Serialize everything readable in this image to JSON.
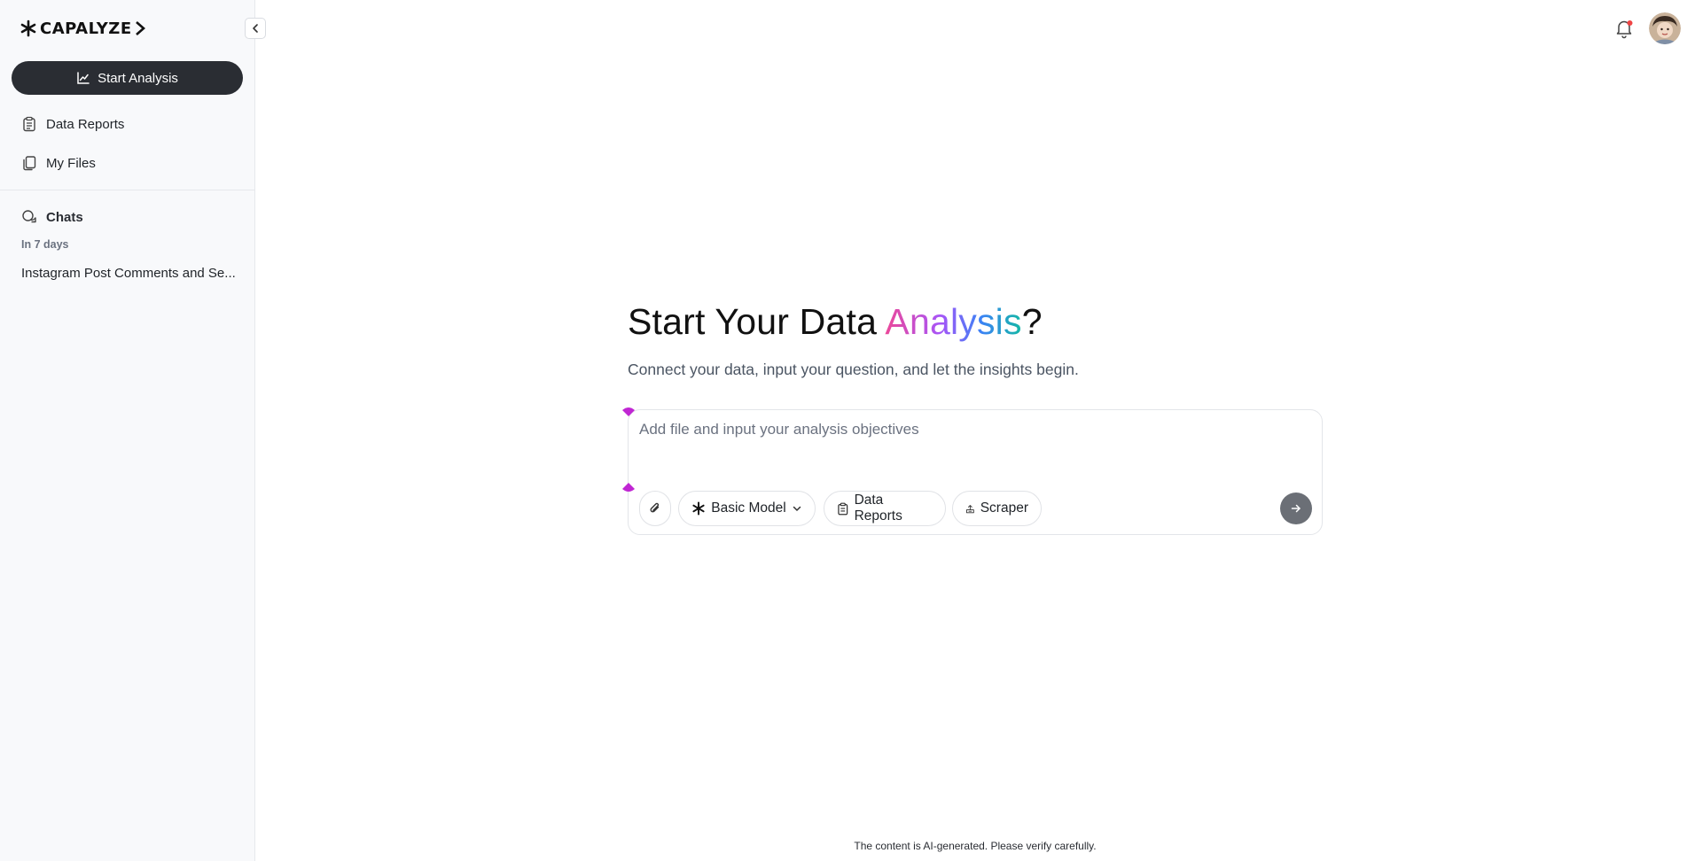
{
  "sidebar": {
    "logo_text": "CAPALYZE",
    "start_button": "Start Analysis",
    "nav": [
      {
        "label": "Data Reports",
        "icon": "clipboard-icon"
      },
      {
        "label": "My Files",
        "icon": "files-icon"
      }
    ],
    "chats_title": "Chats",
    "group_label": "In 7 days",
    "chat_items": [
      "Instagram Post Comments and Se..."
    ]
  },
  "main": {
    "title_prefix": "Start Your Data ",
    "title_highlight": "Analysis",
    "title_suffix": "?",
    "subtitle": "Connect your data, input your question, and let the insights begin.",
    "input_placeholder": "Add file and input your analysis objectives",
    "tools": {
      "model": "Basic Model",
      "data_reports": "Data Reports",
      "scraper": "Scraper"
    },
    "footer_note": "The content is AI-generated. Please verify carefully."
  },
  "colors": {
    "primary_button": "#2a2d33",
    "gradient": [
      "#ec4899",
      "#a855f7",
      "#3b82f6",
      "#14b8a6"
    ],
    "notification_dot": "#ef4444"
  }
}
